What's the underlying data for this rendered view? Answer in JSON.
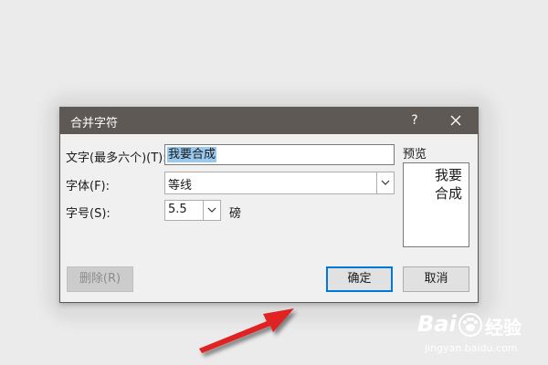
{
  "dialog": {
    "title": "合并字符",
    "help_label": "?",
    "fields": {
      "text_label": "文字(最多六个)(T):",
      "text_value": "我要合成",
      "font_label": "字体(F):",
      "font_value": "等线",
      "size_label": "字号(S):",
      "size_value": "5.5",
      "size_unit": "磅"
    },
    "preview": {
      "label": "预览",
      "line1": "我要",
      "line2": "合成"
    },
    "buttons": {
      "delete": "删除(R)",
      "ok": "确定",
      "cancel": "取消"
    }
  },
  "watermark": {
    "brand": "Bai",
    "brand_suffix": "经验",
    "url": "jingyan.baidu.com"
  },
  "colors": {
    "titlebar": "#5e5955",
    "selection": "#99c9ef",
    "focus": "#0078d7",
    "arrow": "#e02020"
  }
}
